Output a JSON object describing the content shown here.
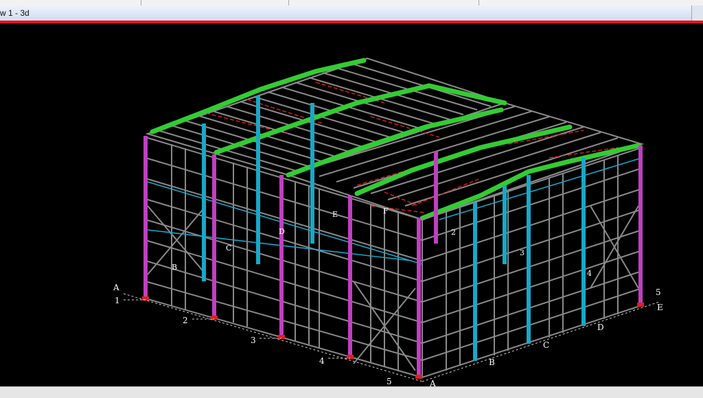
{
  "window": {
    "title": "w 1 - 3d"
  },
  "colors": {
    "background": "#000000",
    "frame_grey": "#8a8a8a",
    "column_magenta": "#c040c0",
    "column_cyan": "#18a8c8",
    "ridge_green": "#33cc33",
    "bracing_red": "#e02020",
    "title_accent": "#e8101a"
  },
  "grid_labels": {
    "left_row": [
      "A",
      "1",
      "2",
      "3",
      "4",
      "5"
    ],
    "right_row": [
      "5",
      "E",
      "4",
      "3",
      "2"
    ],
    "front_axis": [
      "A",
      "B",
      "C",
      "D"
    ],
    "left_wall": [
      "B",
      "C",
      "D",
      "E",
      "F"
    ]
  }
}
